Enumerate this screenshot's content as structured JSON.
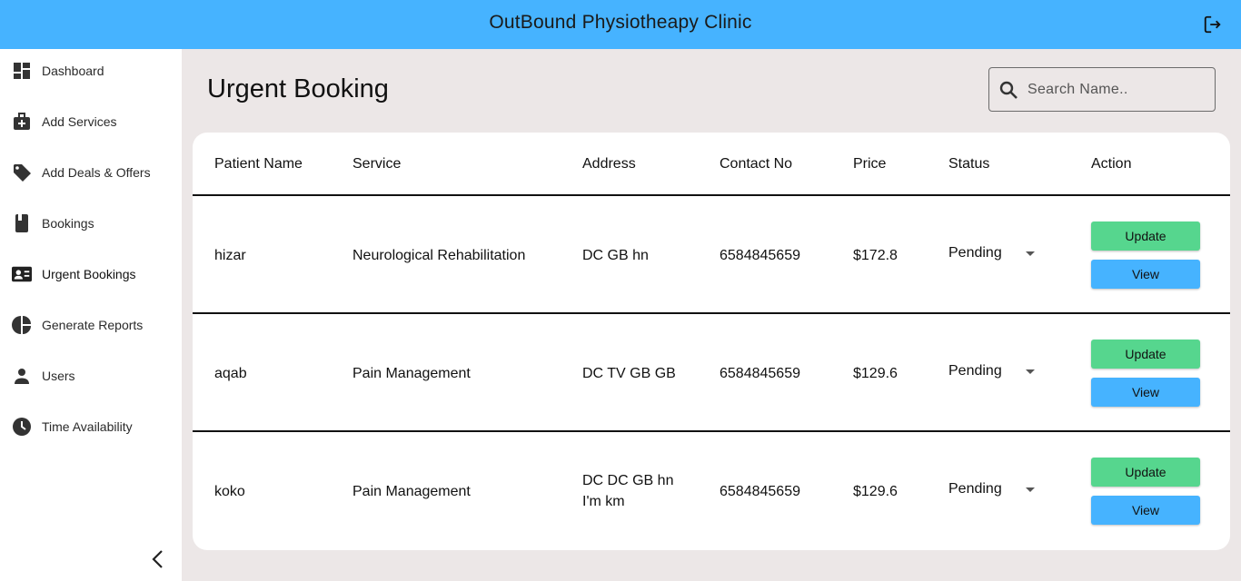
{
  "header": {
    "title": "OutBound Physiotheapy Clinic",
    "logout_icon": "logout-icon"
  },
  "sidebar": {
    "items": [
      {
        "label": "Dashboard",
        "icon": "dashboard-icon"
      },
      {
        "label": "Add Services",
        "icon": "medical-bag-icon"
      },
      {
        "label": "Add Deals & Offers",
        "icon": "tag-icon"
      },
      {
        "label": "Bookings",
        "icon": "book-icon"
      },
      {
        "label": "Urgent Bookings",
        "icon": "contact-card-icon",
        "active": true
      },
      {
        "label": "Generate Reports",
        "icon": "pie-chart-icon"
      },
      {
        "label": "Users",
        "icon": "person-icon"
      },
      {
        "label": "Time Availability",
        "icon": "clock-icon"
      }
    ],
    "collapse_icon": "chevron-left-icon"
  },
  "main": {
    "title": "Urgent Booking",
    "search": {
      "placeholder": "Search Name..",
      "value": ""
    }
  },
  "table": {
    "columns": [
      "Patient Name",
      "Service",
      "Address",
      "Contact No",
      "Price",
      "Status",
      "Action"
    ],
    "rows": [
      {
        "patient": "hizar",
        "service": "Neurological Rehabilitation",
        "address_line1": "DC GB hn",
        "address_line2": "",
        "contact": "6584845659",
        "price": "$172.8",
        "status": "Pending"
      },
      {
        "patient": "aqab",
        "service": "Pain Management",
        "address_line1": "DC TV GB GB",
        "address_line2": "",
        "contact": "6584845659",
        "price": "$129.6",
        "status": "Pending"
      },
      {
        "patient": "koko",
        "service": "Pain Management",
        "address_line1": "DC DC GB hn",
        "address_line2": "I'm km",
        "contact": "6584845659",
        "price": "$129.6",
        "status": "Pending"
      }
    ],
    "update_label": "Update",
    "view_label": "View"
  },
  "colors": {
    "header": "#46b3ff",
    "update_button": "#56d68e",
    "view_button": "#46b3ff",
    "background": "#ece7e7"
  }
}
